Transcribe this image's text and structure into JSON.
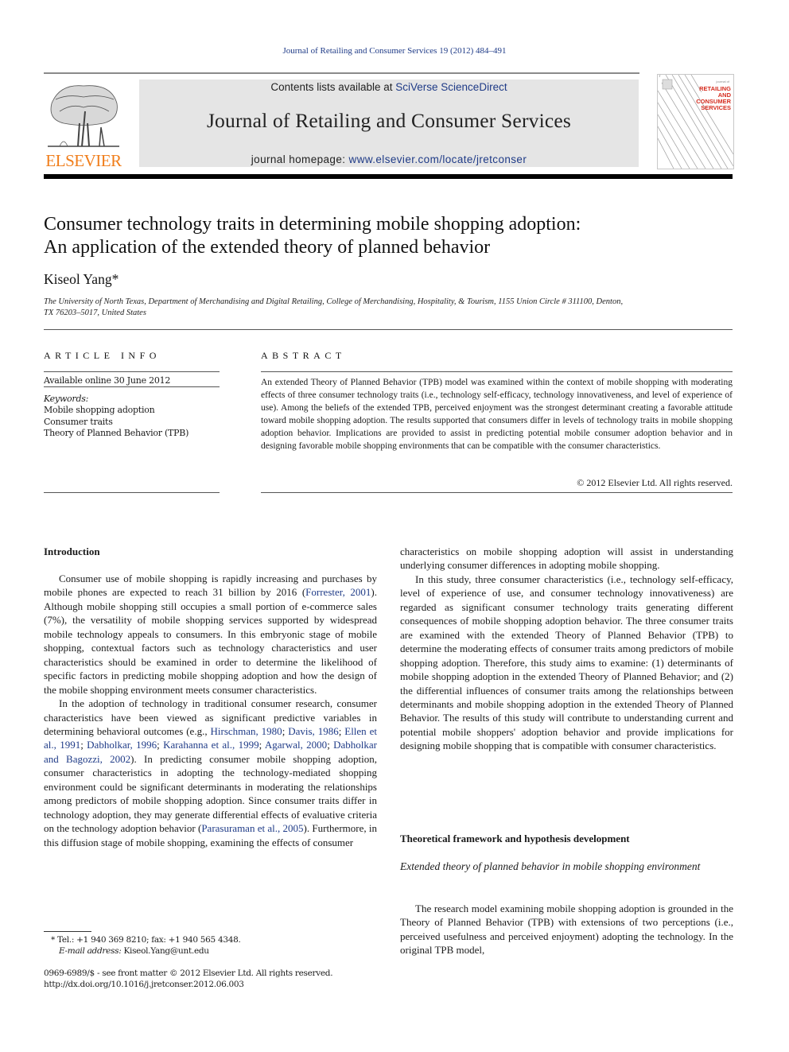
{
  "header": {
    "citation": "Journal of Retailing and Consumer Services 19 (2012) 484–491",
    "contents_prefix": "Contents lists available at ",
    "contents_link": "SciVerse ScienceDirect",
    "journal_title": "Journal of Retailing and Consumer Services",
    "homepage_prefix": "journal homepage: ",
    "homepage_link": "www.elsevier.com/locate/jretconser",
    "publisher_logo_text": "ELSEVIER",
    "cover_small_text": "journal of",
    "cover_title_lines": [
      "RETAILING",
      "AND",
      "CONSUMER",
      "SERVICES"
    ],
    "colors": {
      "link": "#1f3b87",
      "elsevier_orange": "#f07d1a",
      "cover_red": "#d52b1e",
      "banner_bg": "#e5e5e5"
    }
  },
  "article": {
    "title_line1": "Consumer technology traits in determining mobile shopping adoption:",
    "title_line2": "An application of the extended theory of planned behavior",
    "author": "Kiseol Yang",
    "author_mark": "*",
    "affiliation_line1": "The University of North Texas, Department of Merchandising and Digital Retailing, College of Merchandising, Hospitality, & Tourism, 1155 Union Circle # 311100, Denton,",
    "affiliation_line2": "TX 76203–5017, United States"
  },
  "article_info": {
    "heading": "ARTICLE INFO",
    "available_online": "Available online 30 June 2012",
    "keywords_label": "Keywords:",
    "keywords": [
      "Mobile shopping adoption",
      "Consumer traits",
      "Theory of Planned Behavior (TPB)"
    ]
  },
  "abstract": {
    "heading": "ABSTRACT",
    "text": "An extended Theory of Planned Behavior (TPB) model was examined within the context of mobile shopping with moderating effects of three consumer technology traits (i.e., technology self-efficacy, technology innovativeness, and level of experience of use). Among the beliefs of the extended TPB, perceived enjoyment was the strongest determinant creating a favorable attitude toward mobile shopping adoption. The results supported that consumers differ in levels of technology traits in mobile shopping adoption behavior. Implications are provided to assist in predicting potential mobile consumer adoption behavior and in designing favorable mobile shopping environments that can be compatible with the consumer characteristics.",
    "copyright": "© 2012 Elsevier Ltd. All rights reserved."
  },
  "body": {
    "intro_heading": "Introduction",
    "p1": {
      "a": "Consumer use of mobile shopping is rapidly increasing and purchases by mobile phones are expected to reach 31 billion by 2016 (",
      "ref1": "Forrester, 2001",
      "b": "). Although mobile shopping still occupies a small portion of e-commerce sales (7%), the versatility of mobile shopping services supported by widespread mobile technology appeals to consumers. In this embryonic stage of mobile shopping, contextual factors such as technology characteristics and user characteristics should be examined in order to determine the likelihood of specific factors in predicting mobile shopping adoption and how the design of the mobile shopping environment meets consumer characteristics."
    },
    "p2": {
      "a": "In the adoption of technology in traditional consumer research, consumer characteristics have been viewed as significant predictive variables in determining behavioral outcomes (e.g., ",
      "refs": [
        "Hirschman, 1980",
        "Davis, 1986",
        "Ellen et al., 1991",
        "Dabholkar, 1996",
        "Karahanna et al., 1999",
        "Agarwal, 2000",
        "Dabholkar and Bagozzi, 2002"
      ],
      "sep": "; ",
      "b": "). In predicting consumer mobile shopping adoption, consumer characteristics in adopting the technology-mediated shopping environment could be significant determinants in moderating the relationships among predictors of mobile shopping adoption. Since consumer traits differ in technology adoption, they may generate differential effects of evaluative criteria on the technology adoption behavior (",
      "ref_last": "Parasuraman et al., 2005",
      "c": "). Furthermore, in this diffusion stage of mobile shopping, examining the effects of consumer characteristics on mobile shopping adoption will assist in understanding underlying consumer differences in adopting mobile shopping."
    },
    "p2_left_part": "). Furthermore, in this diffusion stage of mobile shopping, examining the effects of consumer",
    "p2_right_part": "characteristics on mobile shopping adoption will assist in understanding underlying consumer differences in adopting mobile shopping.",
    "p3": "In this study, three consumer characteristics (i.e., technology self-efficacy, level of experience of use, and consumer technology innovativeness) are regarded as significant consumer technology traits generating different consequences of mobile shopping adoption behavior. The three consumer traits are examined with the extended Theory of Planned Behavior (TPB) to determine the moderating effects of consumer traits among predictors of mobile shopping adoption. Therefore, this study aims to examine: (1) determinants of mobile shopping adoption in the extended Theory of Planned Behavior; and (2) the differential influences of consumer traits among the relationships between determinants and mobile shopping adoption in the extended Theory of Planned Behavior. The results of this study will contribute to understanding current and potential mobile shoppers' adoption behavior and provide implications for designing mobile shopping that is compatible with consumer characteristics.",
    "tf_heading": "Theoretical framework and hypothesis development",
    "tf_subheading": "Extended theory of planned behavior in mobile shopping environment",
    "p4": "The research model examining mobile shopping adoption is grounded in the Theory of Planned Behavior (TPB) with extensions of two perceptions (i.e., perceived usefulness and perceived enjoyment) adopting the technology. In the original TPB model,"
  },
  "footer": {
    "footnote_mark": "*",
    "footnote_tel": " Tel.: +1 940 369 8210; fax: +1 940 565 4348.",
    "email_label": "E-mail address:",
    "email": " Kiseol.Yang@unt.edu",
    "issn_line": "0969-6989/$ - see front matter © 2012 Elsevier Ltd. All rights reserved.",
    "doi": "http://dx.doi.org/10.1016/j.jretconser.2012.06.003"
  }
}
